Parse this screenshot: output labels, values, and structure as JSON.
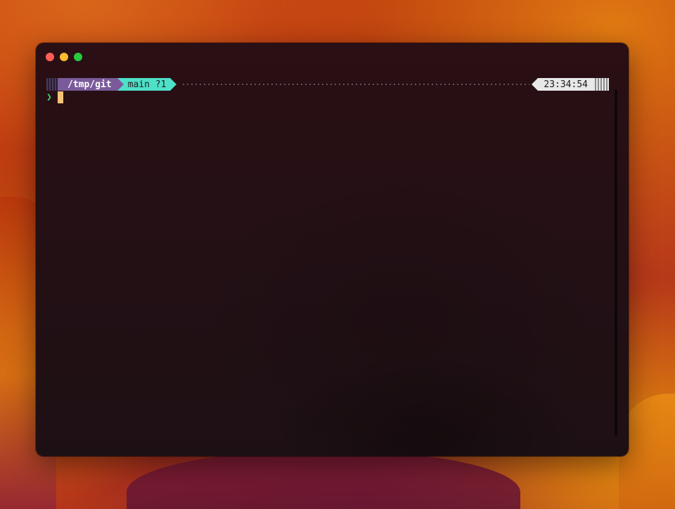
{
  "terminal": {
    "prompt": {
      "directory": "/tmp/git",
      "git_branch": "main",
      "git_status": "?1",
      "time": "23:34:54"
    },
    "input": {
      "prompt_char": "❯",
      "value": ""
    }
  },
  "colors": {
    "dir_segment": "#7a5a9a",
    "git_segment": "#4fe0c8",
    "time_segment": "#e8e8e8",
    "prompt_char": "#3ed96b",
    "cursor": "#f5c27a"
  },
  "icons": {
    "close": "close-icon",
    "minimize": "minimize-icon",
    "maximize": "maximize-icon"
  }
}
